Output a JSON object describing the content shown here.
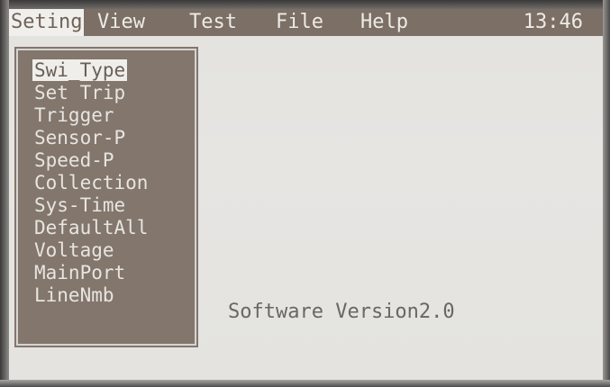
{
  "menubar": {
    "items": [
      {
        "label": "Seting",
        "active": true
      },
      {
        "label": "View"
      },
      {
        "label": "Test"
      },
      {
        "label": "File"
      },
      {
        "label": "Help"
      }
    ],
    "clock": "13:46"
  },
  "dropdown": {
    "items": [
      {
        "label": "Swi_Type",
        "selected": true
      },
      {
        "label": "Set Trip"
      },
      {
        "label": "Trigger"
      },
      {
        "label": "Sensor-P"
      },
      {
        "label": "Speed-P"
      },
      {
        "label": "Collection"
      },
      {
        "label": "Sys-Time"
      },
      {
        "label": "DefaultAll"
      },
      {
        "label": "Voltage"
      },
      {
        "label": "MainPort"
      },
      {
        "label": "LineNmb"
      }
    ]
  },
  "main": {
    "version_text": "Software Version2.0"
  },
  "colors": {
    "menubar_bg": "#7b6f66",
    "menu_text": "#eeebe6",
    "highlight_bg": "#f0eeea",
    "screen_bg": "#e4e3e0"
  }
}
